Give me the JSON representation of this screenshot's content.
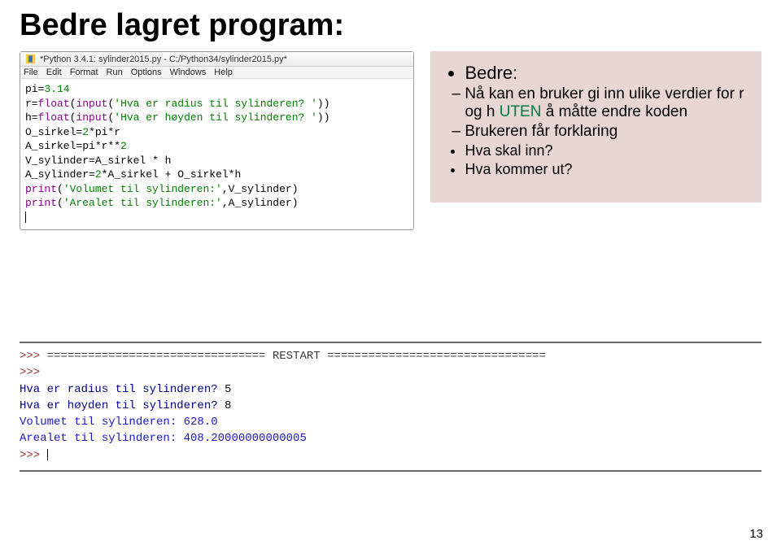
{
  "slide": {
    "title": "Bedre lagret program:",
    "page_number": "13"
  },
  "editor": {
    "icon_name": "python-idle-icon",
    "title": "*Python 3.4.1: sylinder2015.py - C:/Python34/sylinder2015.py*",
    "menu": [
      "File",
      "Edit",
      "Format",
      "Run",
      "Options",
      "Windows",
      "Help"
    ],
    "code": {
      "l1a": "pi=",
      "l1b": "3.14",
      "l2a": "r=",
      "l2b": "float",
      "l2c": "(",
      "l2d": "input",
      "l2e": "(",
      "l2f": "'Hva er radius til sylinderen? '",
      "l2g": "))",
      "l3a": "h=",
      "l3b": "float",
      "l3c": "(",
      "l3d": "input",
      "l3e": "(",
      "l3f": "'Hva er høyden til sylinderen? '",
      "l3g": "))",
      "l4a": "O_sirkel=",
      "l4b": "2",
      "l4c": "*pi*r",
      "l5a": "A_sirkel=pi*r**",
      "l5b": "2",
      "l6a": "V_sylinder=A_sirkel * h",
      "l7a": "A_sylinder=",
      "l7b": "2",
      "l7c": "*A_sirkel + O_sirkel*h",
      "l8a": "print",
      "l8b": "(",
      "l8c": "'Volumet til sylinderen:'",
      "l8d": ",V_sylinder)",
      "l9a": "print",
      "l9b": "(",
      "l9c": "'Arealet til sylinderen:'",
      "l9d": ",A_sylinder)"
    }
  },
  "callout": {
    "header": "Bedre:",
    "item1a": "Nå kan en bruker gi inn ulike verdier for r og h ",
    "item1b_green": "UTEN",
    "item1c": " å måtte endre koden",
    "item2": "Brukeren får forklaring",
    "sub1": "Hva skal inn?",
    "sub2": "Hva kommer ut?"
  },
  "shell": {
    "prompt": ">>> ",
    "restart_line": "================================ RESTART ================================",
    "q1": "Hva er radius til sylinderen? ",
    "a1": "5",
    "q2": "Hva er høyden til sylinderen? ",
    "a2": "8",
    "r1": "Volumet til sylinderen: 628.0",
    "r2": "Arealet til sylinderen: 408.20000000000005"
  }
}
